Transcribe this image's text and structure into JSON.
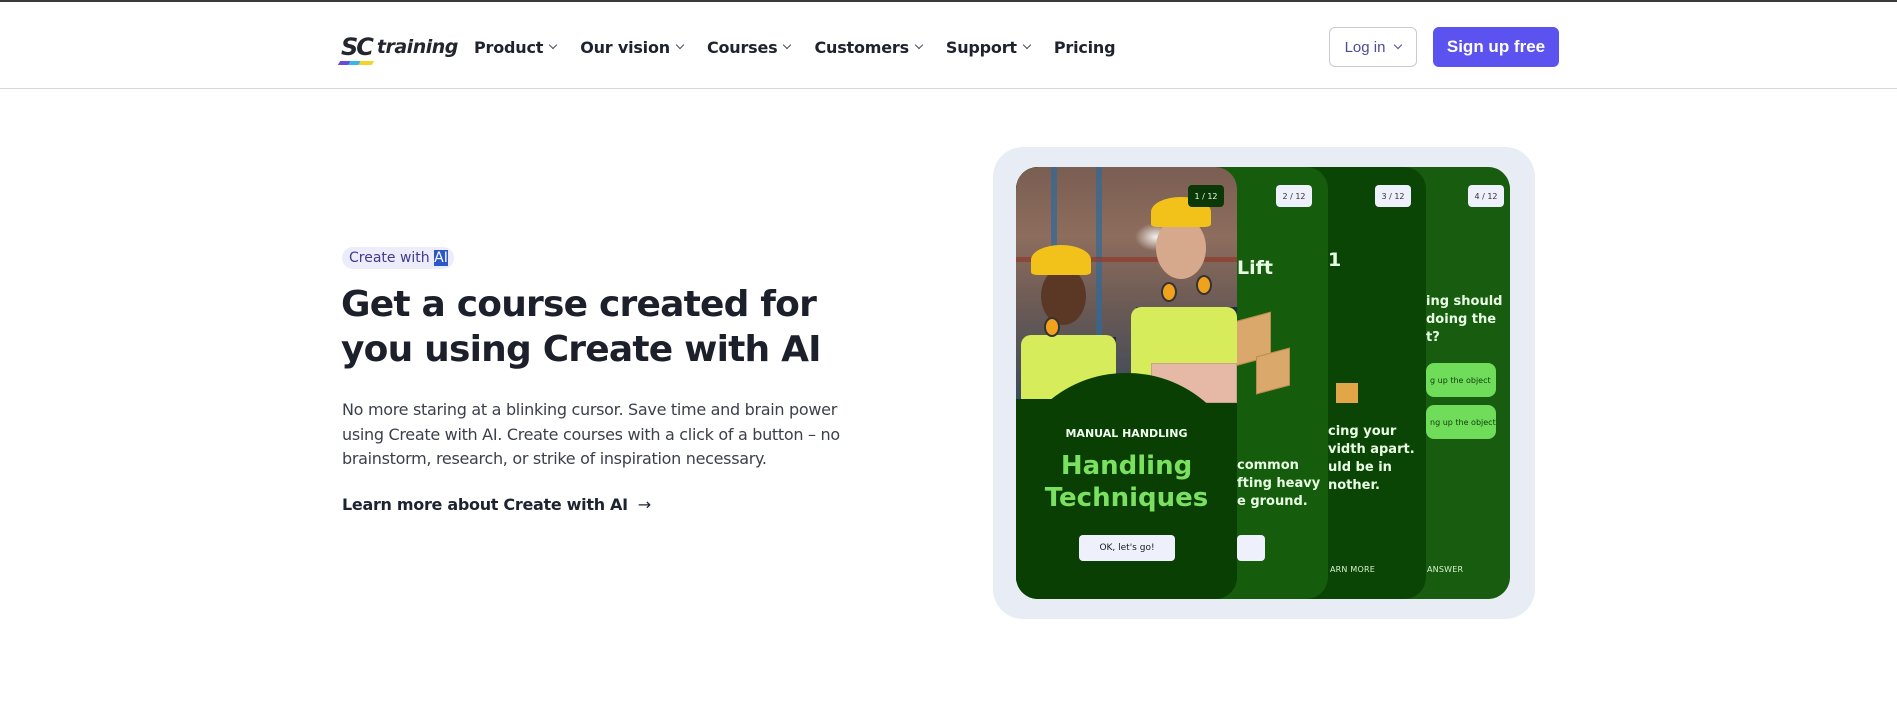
{
  "header": {
    "logo": {
      "mark": "SC",
      "text": "training"
    },
    "nav": [
      {
        "label": "Product",
        "has_dropdown": true
      },
      {
        "label": "Our vision",
        "has_dropdown": true
      },
      {
        "label": "Courses",
        "has_dropdown": true
      },
      {
        "label": "Customers",
        "has_dropdown": true
      },
      {
        "label": "Support",
        "has_dropdown": true
      },
      {
        "label": "Pricing",
        "has_dropdown": false
      }
    ],
    "login_label": "Log in",
    "signup_label": "Sign up free"
  },
  "hero": {
    "badge_prefix": "Create with ",
    "badge_selected": "AI",
    "title": "Get a course created for you using Create with AI",
    "description": "No more staring at a blinking cursor. Save time and brain power using Create with AI. Create courses with a click of a button – no brainstorm, research, or strike of inspiration necessary.",
    "link_label": "Learn more about Create with AI",
    "link_icon": "arrow-right-icon"
  },
  "showcase": {
    "cards": [
      {
        "pager": "1 / 12",
        "kicker": "MANUAL HANDLING",
        "title": "Handling Techniques",
        "button": "OK, let's go!"
      },
      {
        "pager": "2 / 12",
        "title_fragment": "Lift",
        "text_fragment": "common\nfting heavy\ne ground."
      },
      {
        "pager": "3 / 12",
        "title_fragment": "1",
        "text_fragment": "cing your\nvidth apart.\nuld be in\nnother.",
        "footer_label": "ARN MORE"
      },
      {
        "pager": "4 / 12",
        "text_fragment": "ing should\ndoing the\nt?",
        "answers": [
          "g up the object",
          "ng up the object"
        ],
        "footer_label": "ANSWER"
      }
    ]
  },
  "colors": {
    "brand_purple": "#5b52f0",
    "card_green": "#185c0f",
    "card_dark_green": "#0a3f04",
    "accent_green": "#7be05f",
    "panel_bg": "#e8ecf5"
  }
}
